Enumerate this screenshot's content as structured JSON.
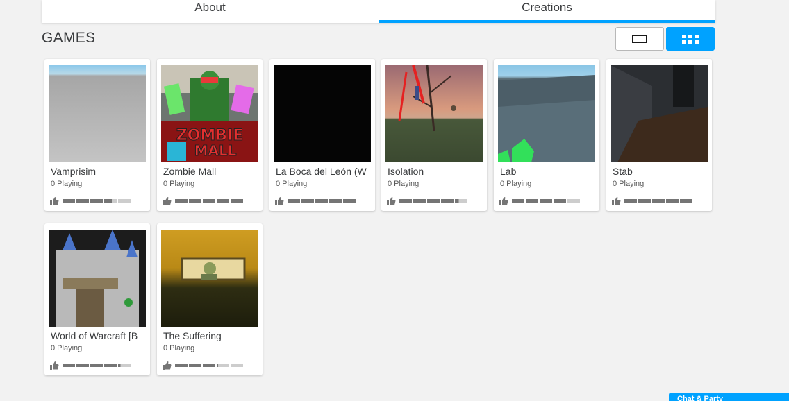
{
  "tabs": [
    {
      "label": "About",
      "active": false
    },
    {
      "label": "Creations",
      "active": true
    }
  ],
  "section": {
    "title": "GAMES"
  },
  "view_toggle": {
    "selected": "grid"
  },
  "games": [
    {
      "name": "Vamprisim",
      "playing": "0 Playing",
      "rating_segments": 3.6,
      "thumb": "t-vampirism"
    },
    {
      "name": "Zombie Mall",
      "playing": "0 Playing",
      "rating_segments": 5.5,
      "thumb": "t-zombie"
    },
    {
      "name": "La Boca del León (W",
      "playing": "0 Playing",
      "rating_segments": 5.5,
      "thumb": "t-boca"
    },
    {
      "name": "Isolation",
      "playing": "0 Playing",
      "rating_segments": 4.3,
      "thumb": "t-isolation"
    },
    {
      "name": "Lab",
      "playing": "0 Playing",
      "rating_segments": 4,
      "thumb": "t-lab"
    },
    {
      "name": "Stab",
      "playing": "0 Playing",
      "rating_segments": 5.3,
      "thumb": "t-stab"
    },
    {
      "name": "World of Warcraft [B",
      "playing": "0 Playing",
      "rating_segments": 4.2,
      "thumb": "t-wow"
    },
    {
      "name": "The Suffering",
      "playing": "0 Playing",
      "rating_segments": 3.1,
      "thumb": "t-suffering"
    }
  ],
  "chat": {
    "label": "Chat & Party"
  },
  "colors": {
    "accent": "#00a2ff",
    "vote_fill": "#757575",
    "vote_empty": "#cdcdcd"
  }
}
